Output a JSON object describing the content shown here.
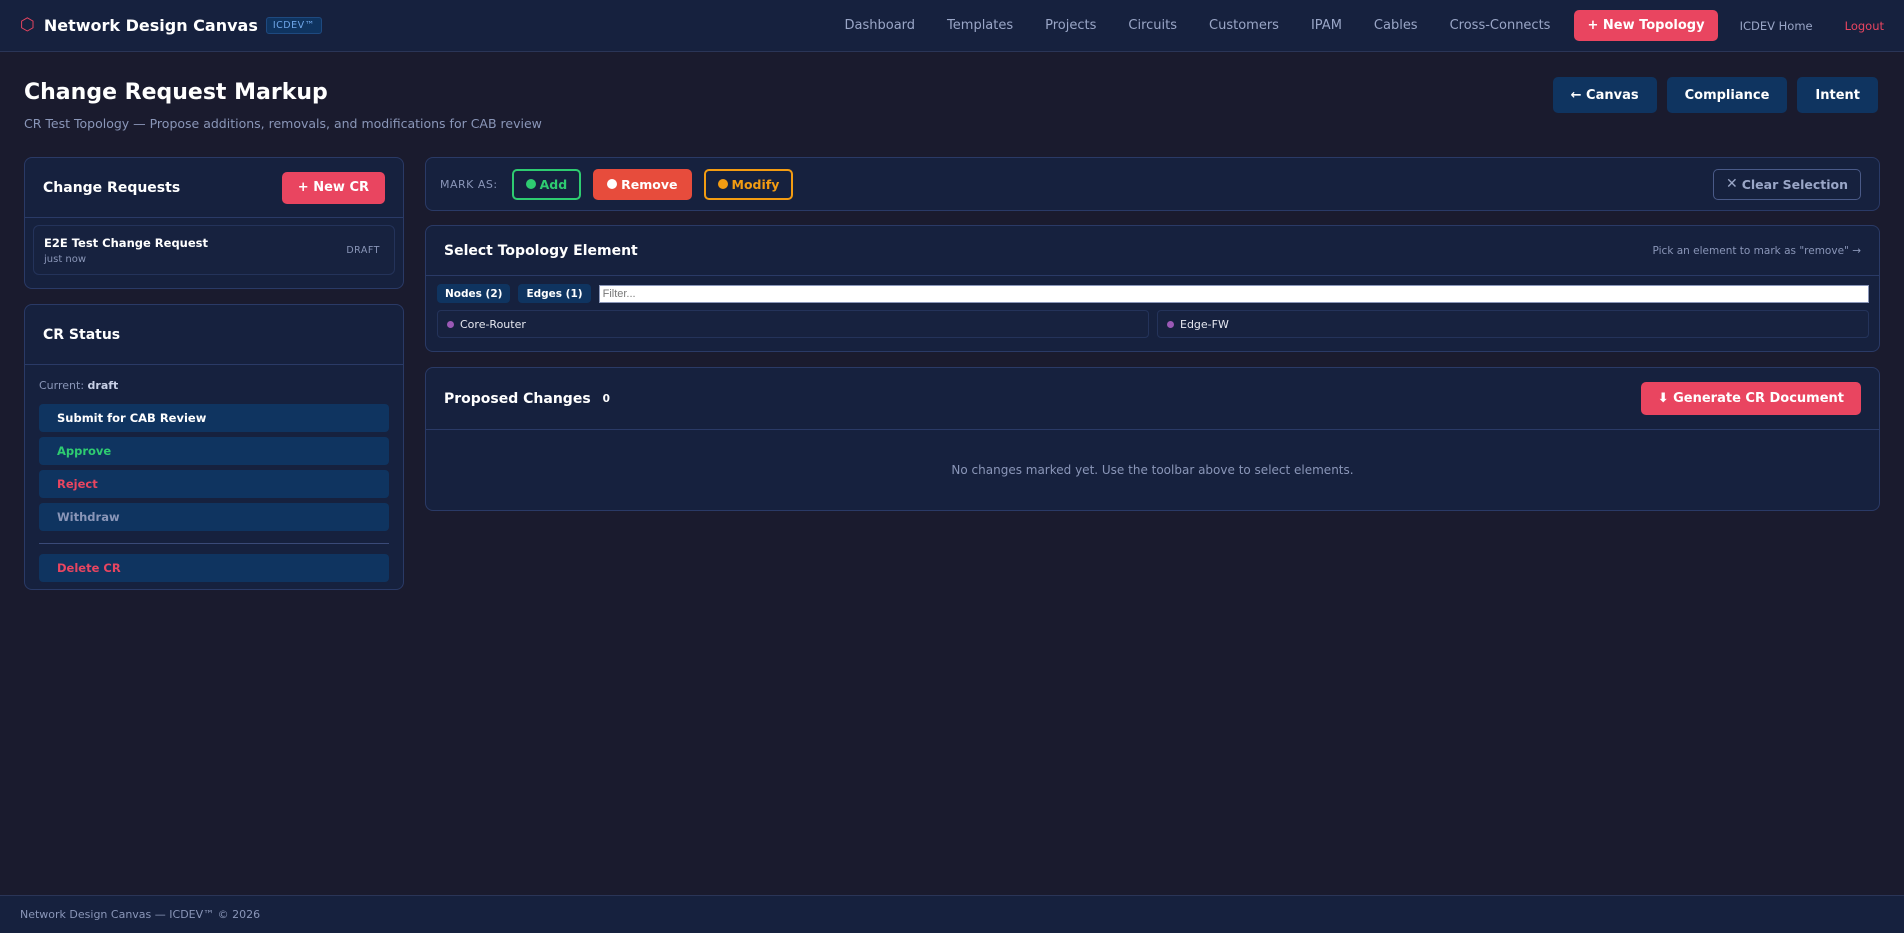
{
  "nav": {
    "brand_icon": "⬡",
    "brand_title": "Network Design Canvas",
    "brand_badge": "ICDEV™",
    "links": [
      "Dashboard",
      "Templates",
      "Projects",
      "Circuits",
      "Customers",
      "IPAM",
      "Cables",
      "Cross-Connects"
    ],
    "new_topology": "+ New Topology",
    "home": "ICDEV Home",
    "logout": "Logout"
  },
  "header": {
    "title": "Change Request Markup",
    "subtitle": "CR Test Topology — Propose additions, removals, and modifications for CAB review",
    "actions": [
      "← Canvas",
      "Compliance",
      "Intent"
    ]
  },
  "change_requests": {
    "title": "Change Requests",
    "new_button": "+ New CR",
    "items": [
      {
        "title": "E2E Test Change Request",
        "time": "just now",
        "status": "DRAFT"
      }
    ]
  },
  "cr_status": {
    "title": "CR Status",
    "current_label": "Current:",
    "current_value": "draft",
    "submit": "Submit for CAB Review",
    "approve": "Approve",
    "reject": "Reject",
    "withdraw": "Withdraw",
    "delete": "Delete CR"
  },
  "toolbar": {
    "mark_as": "MARK AS:",
    "add": "Add",
    "remove": "Remove",
    "modify": "Modify",
    "clear": "Clear Selection"
  },
  "select": {
    "title": "Select Topology Element",
    "hint": "Pick an element to mark as \"remove\" →",
    "nodes_tab": "Nodes (2)",
    "edges_tab": "Edges (1)",
    "filter_placeholder": "Filter...",
    "nodes": [
      "Core-Router",
      "Edge-FW"
    ]
  },
  "proposed": {
    "title": "Proposed Changes",
    "count": "0",
    "generate": "⬇ Generate CR Document",
    "empty": "No changes marked yet. Use the toolbar above to select elements."
  },
  "footer": {
    "text": "Network Design Canvas — ICDEV™ © 2026"
  },
  "colors": {
    "background": "#1a1b2e",
    "panel": "#16213e",
    "accent": "#e94560",
    "button": "#0f3460",
    "add": "#2ecc71",
    "remove": "#e74c3c",
    "modify": "#f39c12",
    "node_dot": "#9b59b6"
  }
}
